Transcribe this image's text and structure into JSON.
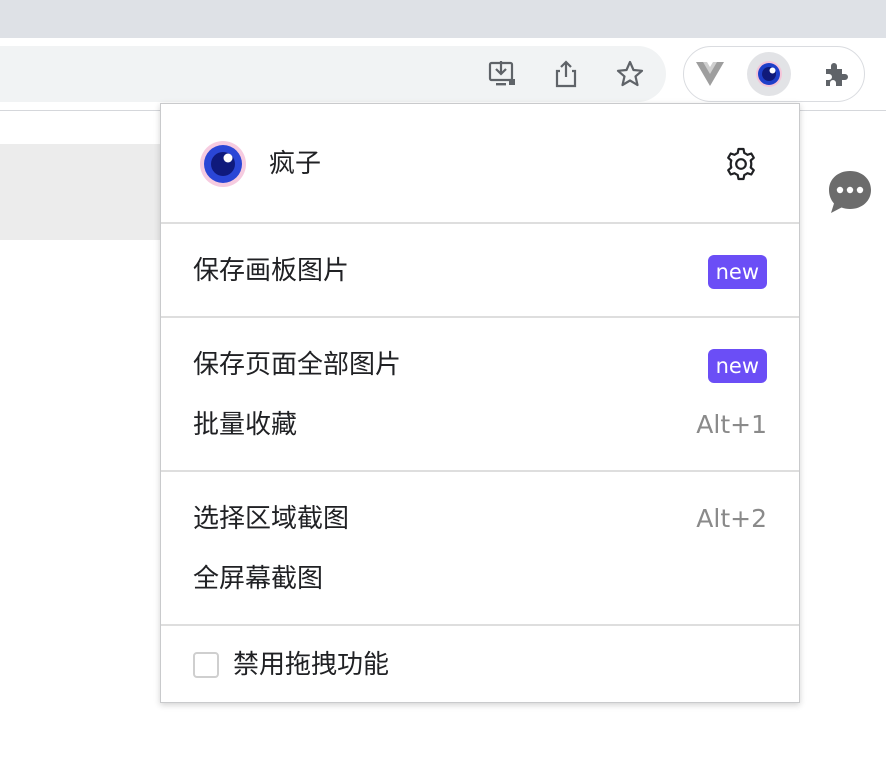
{
  "browser": {
    "toolbar_icons": [
      {
        "name": "install-app-icon"
      },
      {
        "name": "share-icon"
      },
      {
        "name": "bookmark-star-icon"
      }
    ],
    "extensions": [
      {
        "name": "vue-devtools-icon",
        "color": "#9e9e9e"
      },
      {
        "name": "eye-extension-icon",
        "color": "#1f3fc9",
        "active": true
      },
      {
        "name": "puzzle-extensions-icon",
        "color": "#5f6368"
      }
    ]
  },
  "page": {
    "chat_icon": "chat-bubble-icon"
  },
  "popup": {
    "user": {
      "name": "疯子",
      "avatar_icon": "eye-avatar-icon",
      "settings_icon": "gear-icon"
    },
    "sections": [
      {
        "items": [
          {
            "label": "保存画板图片",
            "badge": "new"
          }
        ]
      },
      {
        "items": [
          {
            "label": "保存页面全部图片",
            "badge": "new"
          },
          {
            "label": "批量收藏",
            "shortcut": "Alt+1"
          }
        ]
      },
      {
        "items": [
          {
            "label": "选择区域截图",
            "shortcut": "Alt+2"
          },
          {
            "label": "全屏幕截图"
          }
        ]
      }
    ],
    "footer": {
      "checkbox_label": "禁用拖拽功能",
      "checked": false
    },
    "colors": {
      "badge": "#6b4ef6",
      "shortcut": "#8a8a8a"
    }
  }
}
